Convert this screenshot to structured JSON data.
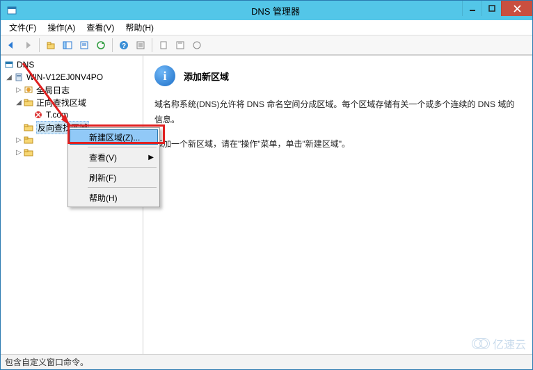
{
  "window": {
    "title": "DNS 管理器"
  },
  "menubar": {
    "file": "文件(F)",
    "action": "操作(A)",
    "view": "查看(V)",
    "help": "帮助(H)"
  },
  "tree": {
    "root": "DNS",
    "server": "WIN-V12EJ0NV4PO",
    "global_log": "全局日志",
    "forward": "正向查找区域",
    "zone_t": "T.com",
    "reverse": "反向查找区域"
  },
  "content": {
    "title": "添加新区域",
    "body1": "域名称系统(DNS)允许将 DNS 命名空间分成区域。每个区域存储有关一个或多个连续的 DNS 域的信息。",
    "body2": "添加一个新区域，请在\"操作\"菜单，单击\"新建区域\"。"
  },
  "context_menu": {
    "new_zone": "新建区域(Z)...",
    "view": "查看(V)",
    "refresh": "刷新(F)",
    "help": "帮助(H)"
  },
  "statusbar": {
    "text": "包含自定义窗口命令。"
  },
  "watermark": {
    "text": "亿速云"
  }
}
